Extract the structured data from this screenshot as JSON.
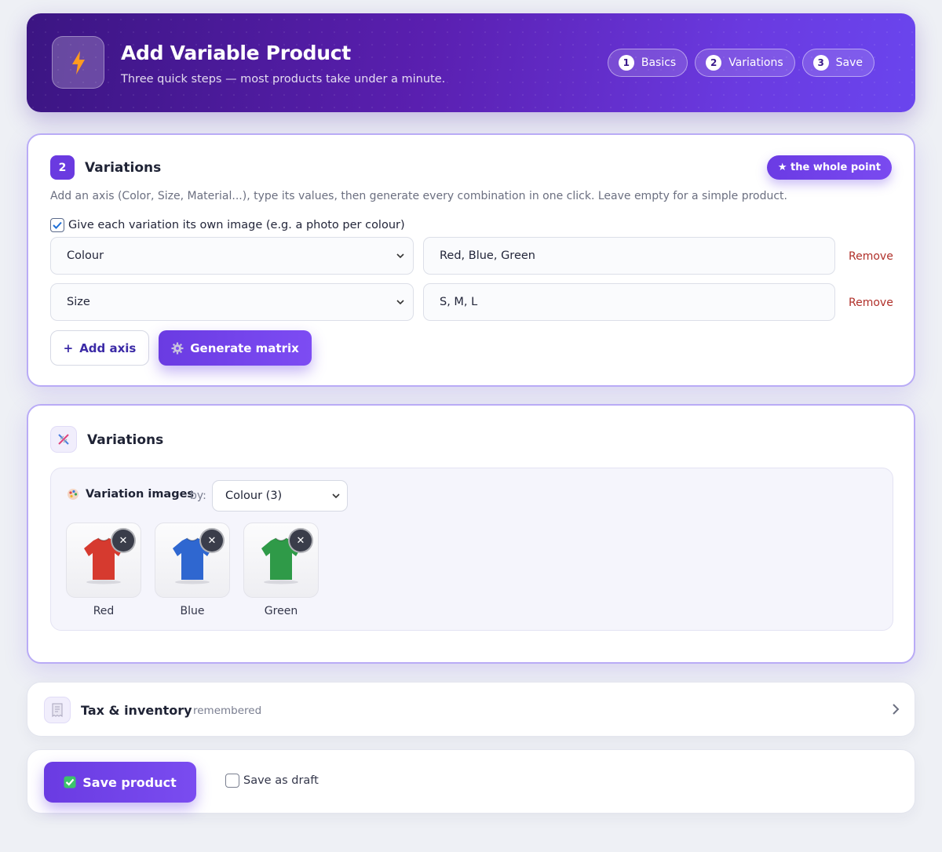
{
  "header": {
    "title": "Add Variable Product",
    "subtitle": "Three quick steps — most products take under a minute.",
    "icon": "lightning-icon",
    "steps": [
      {
        "num": "1",
        "label": "Basics"
      },
      {
        "num": "2",
        "label": "Variations"
      },
      {
        "num": "3",
        "label": "Save"
      }
    ]
  },
  "variations_card": {
    "step_badge": "2",
    "title": "Variations",
    "tag": "★ the whole point",
    "help": "Add an axis (Color, Size, Material...), type its values, then generate every combination in one click. Leave empty for a simple product.",
    "image_option_label": "Give each variation its own image (e.g. a photo per colour)",
    "image_option_checked": true,
    "axes": [
      {
        "name": "Colour",
        "values": "Red, Blue, Green",
        "remove_label": "Remove"
      },
      {
        "name": "Size",
        "values": "S, M, L",
        "remove_label": "Remove"
      }
    ],
    "add_axis_label": "Add axis",
    "generate_label": "Generate matrix"
  },
  "matrix_card": {
    "title": "Variations",
    "icon": "dna-icon",
    "images_title": "Variation images",
    "images_icon": "palette-icon",
    "by_label": "by:",
    "by_selected": "Colour (3)",
    "images": [
      {
        "label": "Red",
        "color": "#d63a2f"
      },
      {
        "label": "Blue",
        "color": "#2f67d0"
      },
      {
        "label": "Green",
        "color": "#2f9a48"
      }
    ]
  },
  "tax_card": {
    "title": "Tax & inventory",
    "subtitle": "remembered",
    "icon": "receipt-icon"
  },
  "footer": {
    "save_label": "Save product",
    "draft_label": "Save as draft",
    "draft_checked": false
  },
  "colors": {
    "accent": "#6a3ae0",
    "remove": "#b0302a"
  }
}
